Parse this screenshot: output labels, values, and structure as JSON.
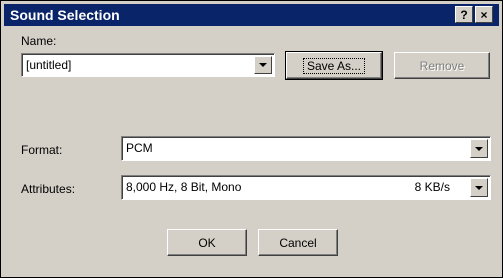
{
  "window": {
    "title": "Sound Selection",
    "help_button": "?",
    "close_button": "×"
  },
  "name": {
    "label": "Name:",
    "value": "[untitled]",
    "save_as_button": "Save As...",
    "remove_button": "Remove"
  },
  "format": {
    "label": "Format:",
    "value": "PCM"
  },
  "attributes": {
    "label": "Attributes:",
    "value": "8,000 Hz, 8 Bit, Mono",
    "rate": "8 KB/s"
  },
  "buttons": {
    "ok": "OK",
    "cancel": "Cancel"
  }
}
